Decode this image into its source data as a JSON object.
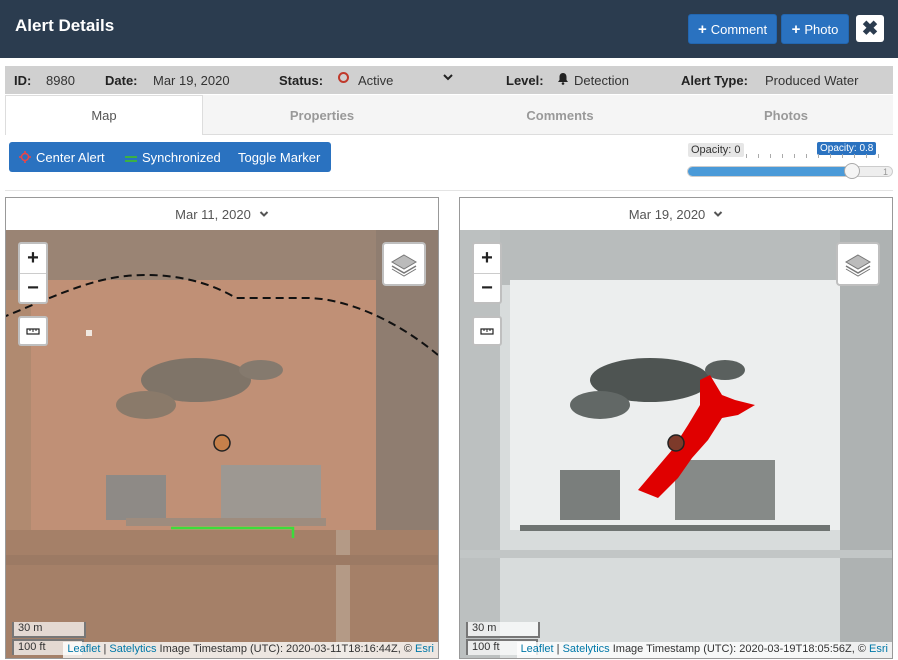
{
  "header": {
    "title": "Alert Details",
    "comment_label": "Comment",
    "photo_label": "Photo",
    "close": "✖"
  },
  "info": {
    "id_label": "ID:",
    "id": "8980",
    "date_label": "Date:",
    "date": "Mar 19, 2020",
    "status_label": "Status:",
    "status": "Active",
    "level_label": "Level:",
    "level": "Detection",
    "type_label": "Alert Type:",
    "type": "Produced Water"
  },
  "tabs": [
    "Map",
    "Properties",
    "Comments",
    "Photos"
  ],
  "toolbar": {
    "center": "Center Alert",
    "sync": "Synchronized",
    "toggle": "Toggle Marker"
  },
  "opacity": {
    "min_label": "Opacity: 0",
    "value_label": "Opacity: 0.8",
    "max_label": "1",
    "value": 0.8
  },
  "left_map": {
    "date": "Mar 11, 2020",
    "timestamp": "Image Timestamp (UTC): 2020-03-11T18:16:44Z, ©"
  },
  "right_map": {
    "date": "Mar 19, 2020",
    "timestamp": "Image Timestamp (UTC): 2020-03-19T18:05:56Z, ©"
  },
  "map_common": {
    "zoom_in": "+",
    "zoom_out": "−",
    "scale_m": "30 m",
    "scale_ft": "100 ft",
    "leaflet": "Leaflet",
    "satelytics": "Satelytics",
    "esri": "Esri",
    "sep": "|"
  },
  "colors": {
    "header": "#2b3c4f",
    "accent": "#2a72c0",
    "status": "#c0392b",
    "spill": "#e00000",
    "sync": "#3cb043"
  }
}
